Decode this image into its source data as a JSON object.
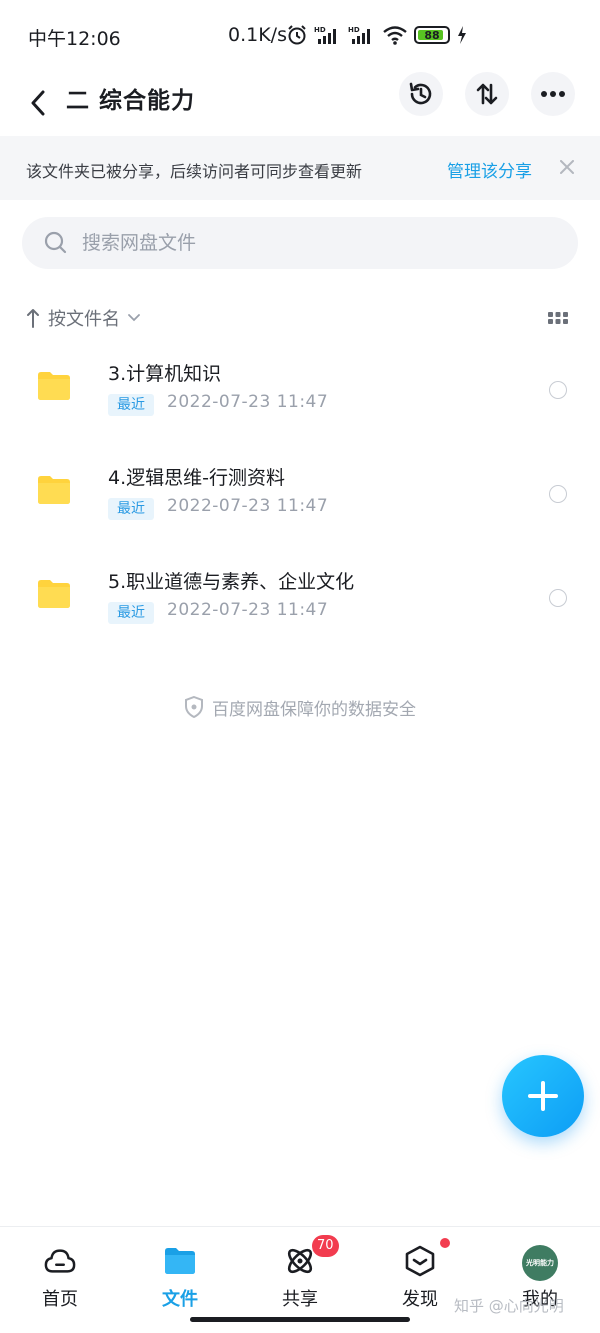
{
  "status_bar": {
    "time": "中午12:06",
    "net_speed": "0.1K/s",
    "battery_level": 88,
    "battery_text": "88"
  },
  "header": {
    "title": "二 综合能力"
  },
  "share_banner": {
    "message": "该文件夹已被分享，后续访问者可同步查看更新",
    "action": "管理该分享"
  },
  "search": {
    "placeholder": "搜索网盘文件"
  },
  "sort": {
    "label": "按文件名"
  },
  "files": [
    {
      "name": "3.计算机知识",
      "badge": "最近",
      "date": "2022-07-23  11:47"
    },
    {
      "name": "4.逻辑思维-行测资料",
      "badge": "最近",
      "date": "2022-07-23  11:47"
    },
    {
      "name": "5.职业道德与素养、企业文化",
      "badge": "最近",
      "date": "2022-07-23  11:47"
    }
  ],
  "security_note": "百度网盘保障你的数据安全",
  "bottom_nav": {
    "home": "首页",
    "files": "文件",
    "share": "共享",
    "share_badge": "70",
    "discover": "发现",
    "mine": "我的",
    "avatar_text": "光明能力"
  },
  "watermark": "知乎 @心向光明",
  "colors": {
    "accent": "#1aa0e6",
    "folder": "#ffd33d",
    "badge_red": "#f23c4f"
  }
}
